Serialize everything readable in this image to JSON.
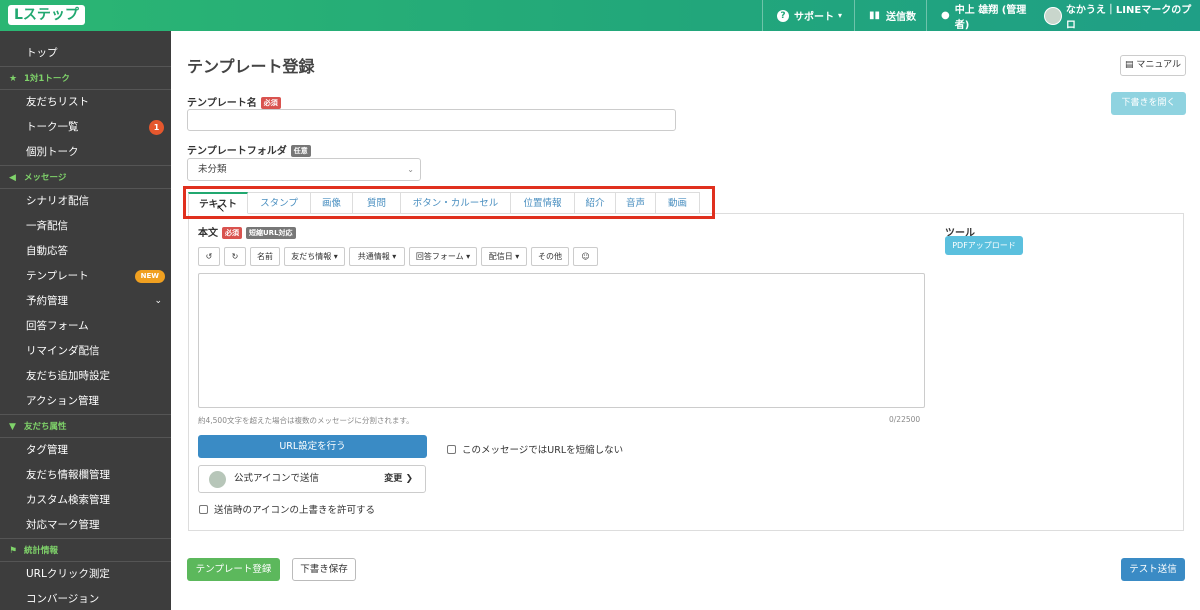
{
  "header": {
    "logo": "Lステップ",
    "support": "サポート",
    "stats": "送信数",
    "user": "中上 雄翔 (管理者)",
    "account": "なかうえ｜LINEマークのプロ"
  },
  "sidebar": {
    "top": "トップ",
    "sections": [
      {
        "title": "1対1トーク",
        "items": [
          "友だちリスト",
          "トーク一覧",
          "個別トーク"
        ]
      },
      {
        "title": "メッセージ",
        "items": [
          "シナリオ配信",
          "一斉配信",
          "自動応答",
          "テンプレート",
          "予約管理",
          "回答フォーム",
          "リマインダ配信",
          "友だち追加時設定",
          "アクション管理"
        ]
      },
      {
        "title": "友だち属性",
        "items": [
          "タグ管理",
          "友だち情報欄管理",
          "カスタム検索管理",
          "対応マーク管理"
        ]
      },
      {
        "title": "統計情報",
        "items": [
          "URLクリック測定",
          "コンバージョン"
        ]
      }
    ],
    "talk_badge": "1",
    "new_badge": "NEW"
  },
  "page": {
    "title": "テンプレート登録",
    "manual_btn": "マニュアル",
    "open_draft_btn": "下書きを開く",
    "name_label": "テンプレート名",
    "required": "必須",
    "optional": "任意",
    "folder_label": "テンプレートフォルダ",
    "folder_value": "未分類",
    "tabs": [
      "テキスト",
      "スタンプ",
      "画像",
      "質問",
      "ボタン・カルーセル",
      "位置情報",
      "紹介",
      "音声",
      "動画"
    ],
    "body_label": "本文",
    "short_url_tag": "短縮URL対応",
    "tools_label": "ツール",
    "pdf_btn": "PDFアップロード",
    "toolbar": {
      "undo": "↺",
      "redo": "↻",
      "name": "名前",
      "friend_info": "友だち情報",
      "common_info": "共通情報",
      "form": "回答フォーム",
      "date": "配信日",
      "other": "その他",
      "emoji": "☺"
    },
    "note": "約4,500文字を超えた場合は複数のメッセージに分割されます。",
    "counter": "0/22500",
    "url_btn": "URL設定を行う",
    "no_shorten": "このメッセージではURLを短縮しない",
    "send_icon": "公式アイコンで送信",
    "change": "変更",
    "allow_override": "送信時のアイコンの上書きを許可する",
    "register_btn": "テンプレート登録",
    "save_draft_btn": "下書き保存",
    "test_send_btn": "テスト送信"
  }
}
